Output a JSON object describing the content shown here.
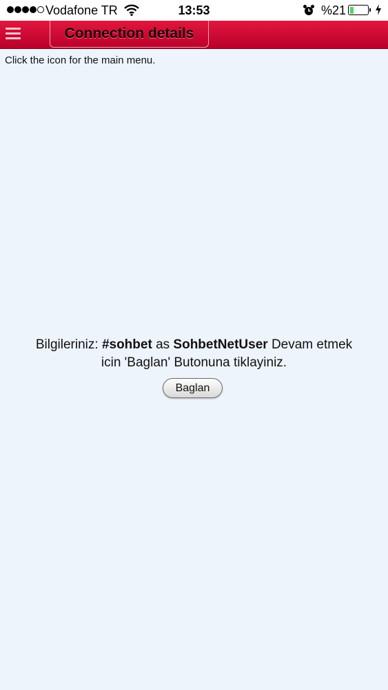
{
  "status_bar": {
    "carrier": "Vodafone TR",
    "time": "13:53",
    "battery_percent": "%21",
    "battery_level": 0.21,
    "signal_bars_filled": 4,
    "signal_bars_total": 5
  },
  "header": {
    "title": "Connection details",
    "menu_icon": "hamburger-icon"
  },
  "hint_text": "Click the icon for the main menu.",
  "message": {
    "prefix": "Bilgileriniz: ",
    "channel": "#sohbet",
    "as": " as ",
    "user": "SohbetNetUser",
    "line1_suffix": " Devam etmek",
    "line2": "icin 'Baglan' Butonuna tiklayiniz."
  },
  "connect_button": {
    "label": "Baglan"
  },
  "colors": {
    "header_top": "#e2173f",
    "header_bottom": "#b9002a",
    "page_background": "#eef4fc",
    "battery_green": "#4cd964"
  }
}
